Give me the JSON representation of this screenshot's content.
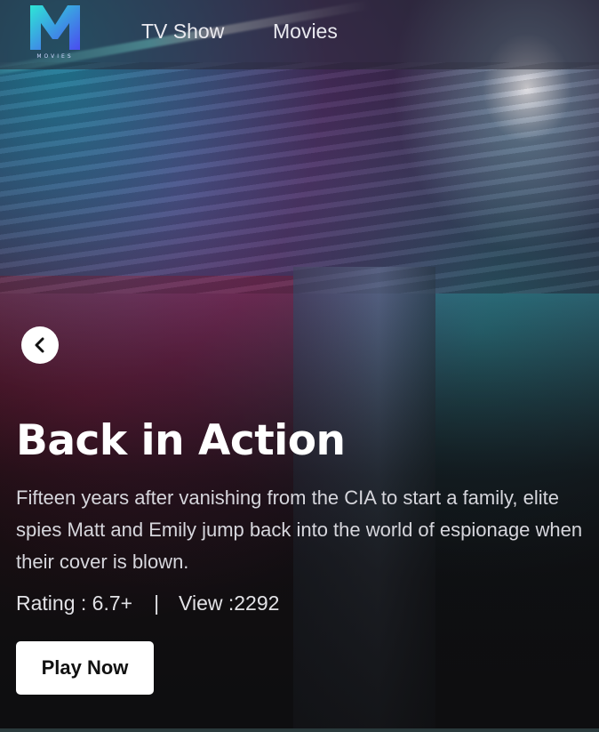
{
  "app": {
    "logo_letter": "M",
    "logo_text": "MOVIES"
  },
  "nav": {
    "items": [
      {
        "label": "TV Show"
      },
      {
        "label": "Movies"
      }
    ]
  },
  "hero": {
    "title": "Back in Action",
    "description": "Fifteen years after vanishing from the CIA to start a family, elite spies Matt and Emily jump back into the world of espionage when their cover is blown.",
    "rating": "Rating : 6.7+",
    "separator": "|",
    "views": "View :2292",
    "play_label": "Play Now"
  },
  "colors": {
    "logo_gradient_start": "#2ee6d6",
    "logo_gradient_end": "#4a4cf0",
    "button_bg": "#ffffff",
    "text_primary": "#ffffff"
  },
  "icons": {
    "back": "chevron-left-icon"
  }
}
